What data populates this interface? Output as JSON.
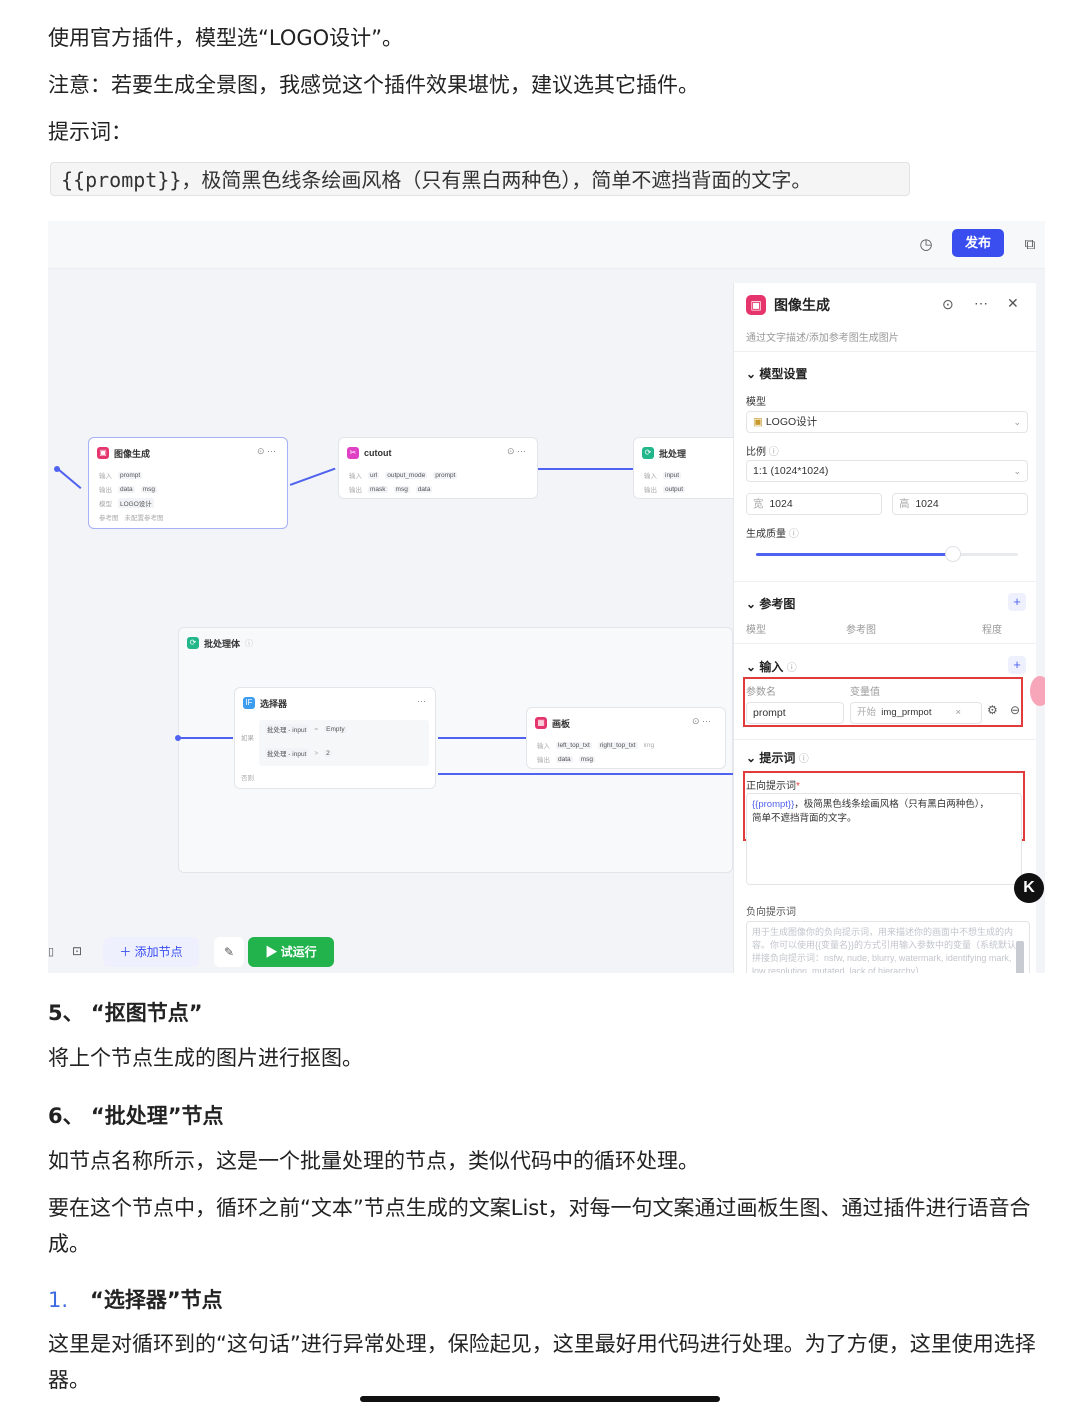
{
  "article": {
    "p1": "使用官方插件，模型选“LOGO设计”。",
    "p2": "注意：若要生成全景图，我感觉这个插件效果堪忧，建议选其它插件。",
    "p3": "提示词：",
    "code": "{{prompt}}，极简黑色线条绘画风格（只有黑白两种色），简单不遮挡背面的文字。",
    "h5": "5、 “抠图节点”",
    "p5": "将上个节点生成的图片进行抠图。",
    "h6": "6、 “批处理”节点",
    "p6a": "如节点名称所示，这是一个批量处理的节点，类似代码中的循环处理。",
    "p6b": "要在这个节点中，循环之前“文本”节点生成的文案List，对每一句文案通过画板生图、通过插件进行语音合成。",
    "h1_num": "1.",
    "h1_text": "“选择器”节点",
    "p7": "这里是对循环到的“这句话”进行异常处理，保险起见，这里最好用代码进行处理。为了方便，这里使用选择器。"
  },
  "app": {
    "publish": "发布",
    "nodes": {
      "imggen": {
        "title": "图像生成",
        "in_label": "输入",
        "in_val": "prompt",
        "out_label": "输出",
        "out_a": "data",
        "out_b": "msg",
        "model_label": "模型",
        "model_val": "LOGO设计",
        "ref_label": "参考图",
        "ref_val": "未配置参考图"
      },
      "cutout": {
        "title": "cutout",
        "in_label": "输入",
        "in_a": "url",
        "in_b": "output_mode",
        "in_c": "prompt",
        "out_label": "输出",
        "out_a": "mask",
        "out_b": "msg",
        "out_c": "data"
      },
      "batch_small": {
        "title": "批处理",
        "in_label": "输入",
        "in_val": "input",
        "out_label": "输出",
        "out_val": "output"
      },
      "batch_body": {
        "title": "批处理体"
      },
      "selector": {
        "title": "选择器",
        "r1_a": "批处理 - input",
        "r1_b": "Empty",
        "r2_a": "批处理 - input",
        "r2_b": "2",
        "cond_if": "如果",
        "cond_then": "否则"
      },
      "canvas_node": {
        "title": "画板",
        "in_label": "输入",
        "in_a": "left_top_txt",
        "in_b": "right_top_txt",
        "in_c": "img",
        "out_label": "输出",
        "out_a": "data",
        "out_b": "msg"
      }
    },
    "bottom": {
      "add_node": "添加节点",
      "test_run": "试运行"
    },
    "panel": {
      "title": "图像生成",
      "subtitle": "通过文字描述/添加参考图生成图片",
      "model_section": "模型设置",
      "model_label": "模型",
      "model_value": "LOGO设计",
      "ratio_label": "比例",
      "ratio_value": "1:1 (1024*1024)",
      "width_label": "宽",
      "width_value": "1024",
      "height_label": "高",
      "height_value": "1024",
      "quality_label": "生成质量",
      "quality_level": 0.75,
      "ref_section": "参考图",
      "ref_col1": "模型",
      "ref_col2": "参考图",
      "ref_col3": "程度",
      "input_section": "输入",
      "input_col1": "参数名",
      "input_col2": "变量值",
      "input_param": "prompt",
      "input_src": "开始",
      "input_var": "img_prmpot",
      "prompt_section": "提示词",
      "pos_label": "正向提示词",
      "pos_var": "{{prompt}}",
      "pos_text1": "，极简黑色线条绘画风格（只有黑白两种色），",
      "pos_text2": "简单不遮挡背面的文字。",
      "neg_label": "负向提示词",
      "neg_placeholder": "用于生成图像你的负向提示词，用来描述你的画面中不想生成的内容。你可以使用{{变量名}}的方式引用输入参数中的变量（系统默认拼接负向提示词：nsfw, nude, blurry, watermark, identifying mark, low resolution, mutated, lack of hierarchy）"
    }
  }
}
